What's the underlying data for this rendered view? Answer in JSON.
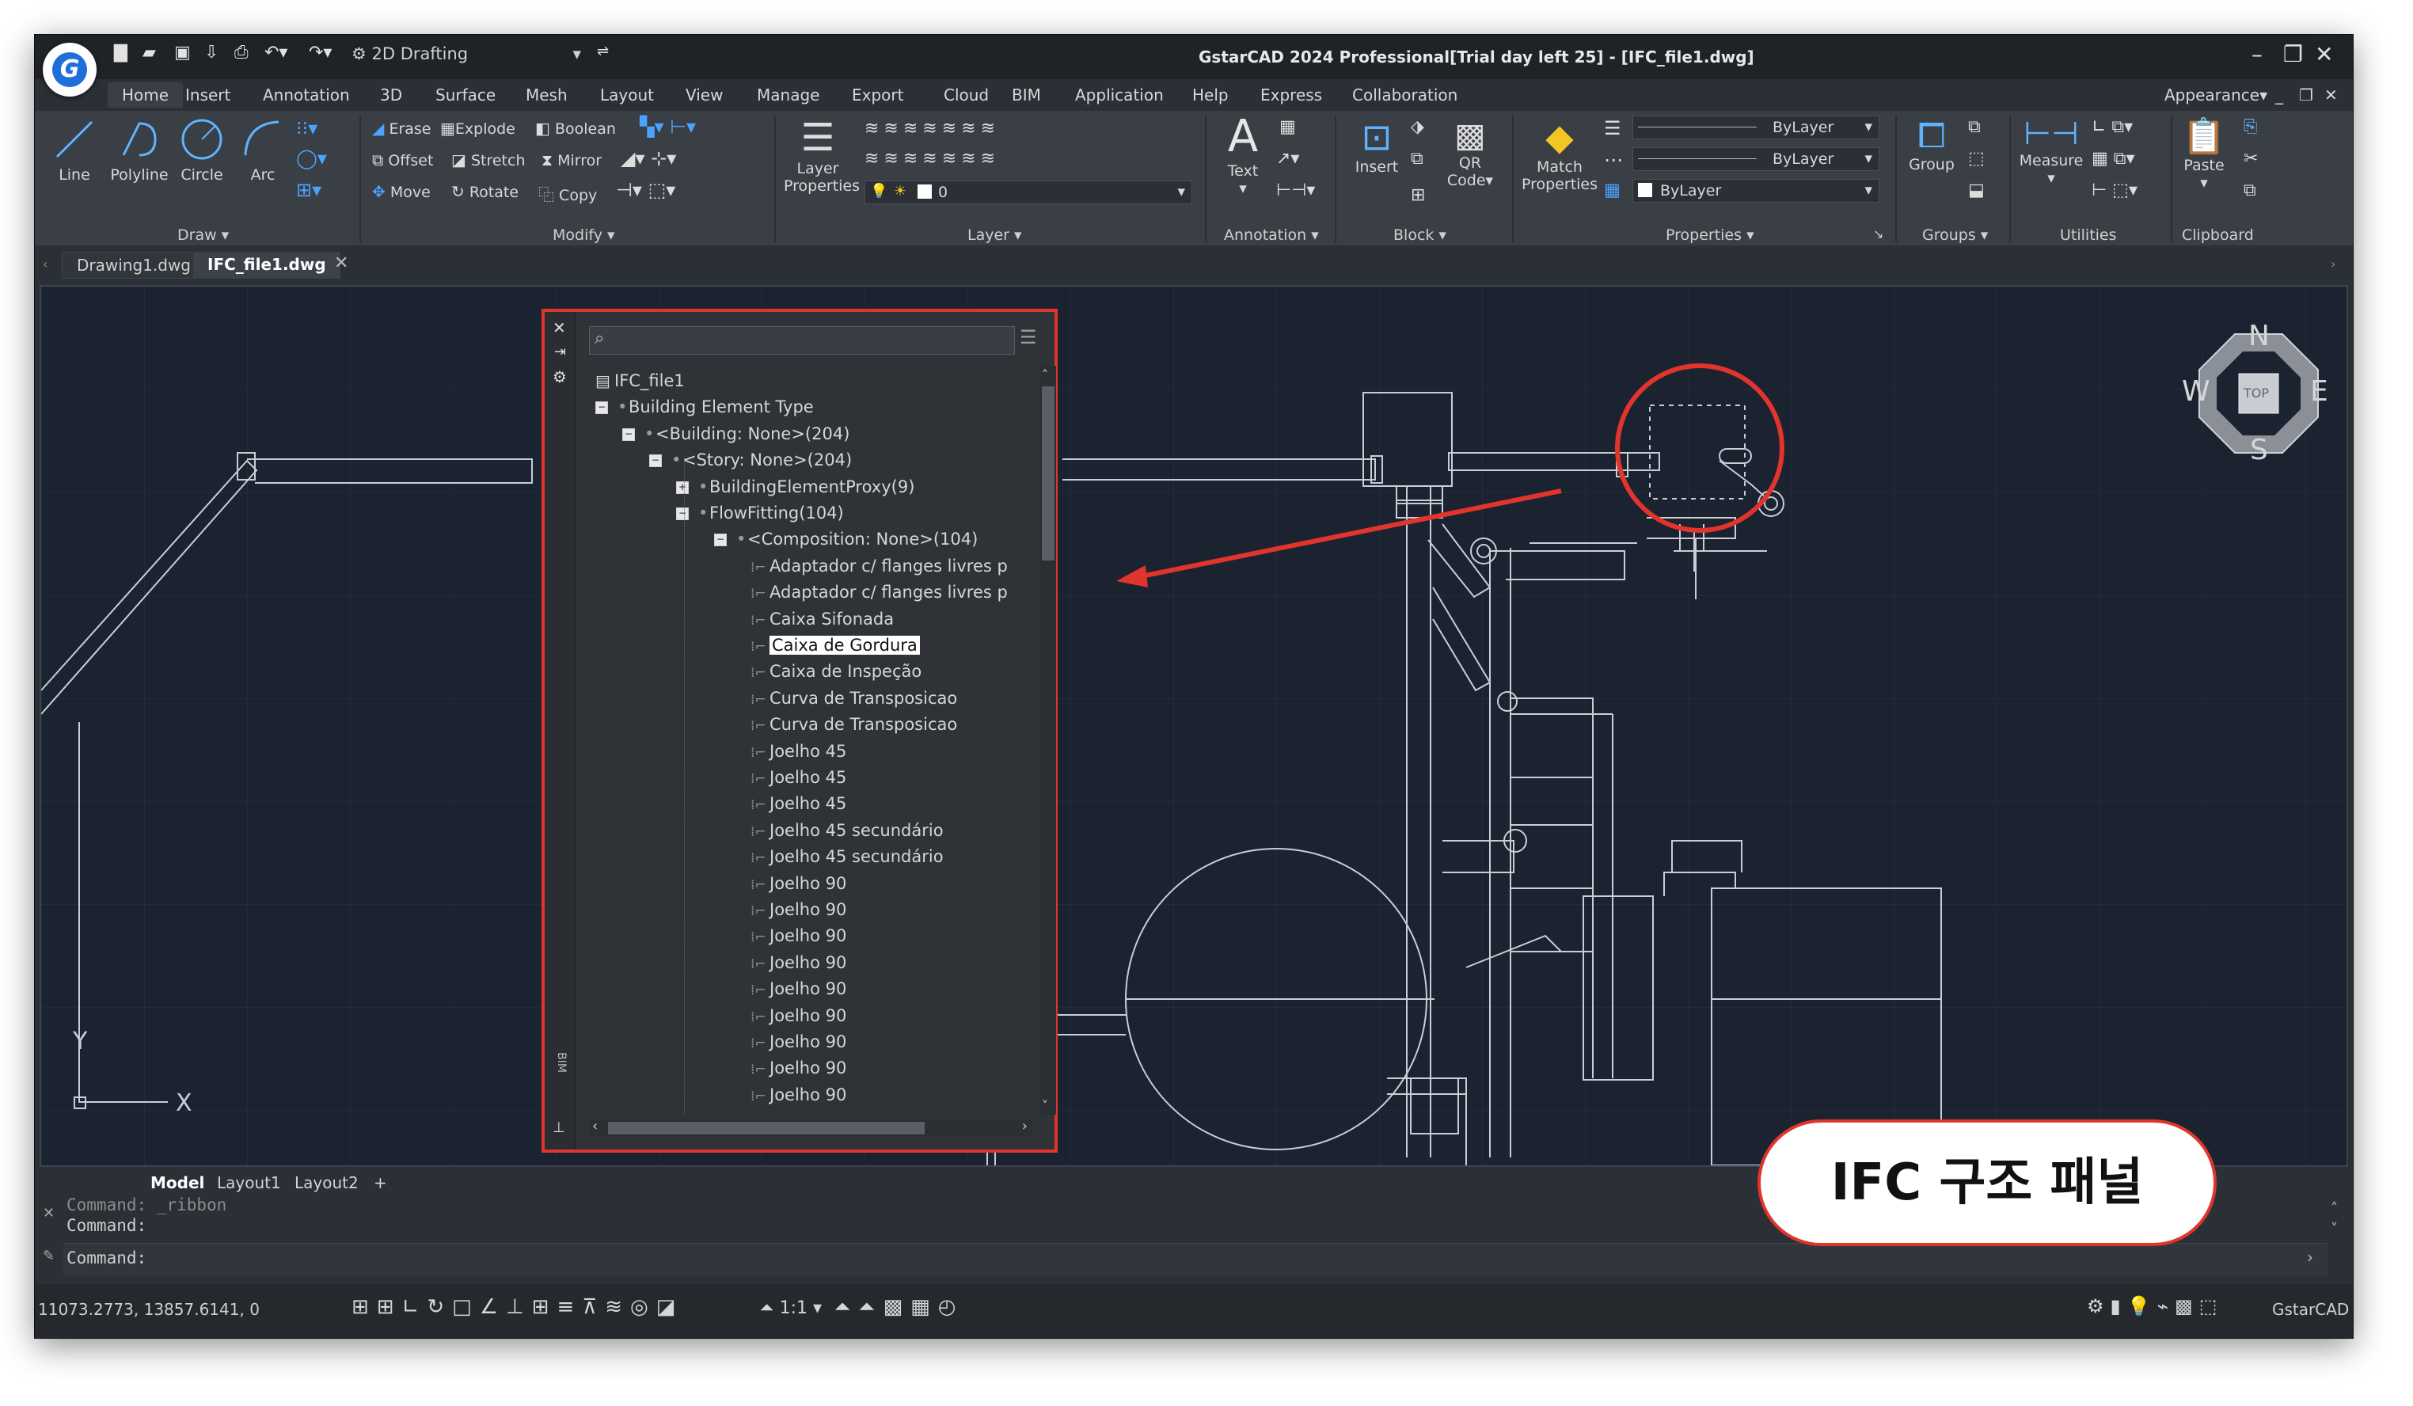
{
  "app": {
    "title": "GstarCAD 2024 Professional[Trial day left 25] - [IFC_file1.dwg]",
    "workspace": "2D Drafting",
    "appearance": "Appearance"
  },
  "menu": [
    "Home",
    "Insert",
    "Annotation",
    "3D",
    "Surface",
    "Mesh",
    "Layout",
    "View",
    "Manage",
    "Export",
    "Cloud",
    "BIM",
    "Application",
    "Help",
    "Express",
    "Collaboration"
  ],
  "ribbon": {
    "draw": {
      "group": "Draw",
      "line": "Line",
      "polyline": "Polyline",
      "circle": "Circle",
      "arc": "Arc"
    },
    "modify": {
      "group": "Modify",
      "erase": "Erase",
      "explode": "Explode",
      "boolean": "Boolean",
      "offset": "Offset",
      "stretch": "Stretch",
      "mirror": "Mirror",
      "move": "Move",
      "rotate": "Rotate",
      "copy": "Copy"
    },
    "layer": {
      "group": "Layer",
      "layer_props": "Layer",
      "layer_props2": "Properties",
      "current_layer": "0"
    },
    "annotation": {
      "group": "Annotation",
      "text": "Text"
    },
    "block": {
      "group": "Block",
      "insert": "Insert",
      "qr": "QR",
      "qr2": "Code"
    },
    "properties": {
      "group": "Properties",
      "match": "Match",
      "match2": "Properties",
      "bylayer1": "ByLayer",
      "bylayer2": "ByLayer",
      "bylayer3": "ByLayer"
    },
    "groups": {
      "group": "Groups",
      "group_btn": "Group"
    },
    "utilities": {
      "group": "Utilities",
      "measure": "Measure"
    },
    "clipboard": {
      "group": "Clipboard",
      "paste": "Paste"
    }
  },
  "doc_tabs": [
    "Drawing1.dwg",
    "IFC_file1.dwg"
  ],
  "layout_tabs": [
    "Model",
    "Layout1",
    "Layout2",
    "+"
  ],
  "command": {
    "line1": "Command: _ribbon",
    "line2": "Command:",
    "line3": "Command:"
  },
  "status": {
    "coords": "11073.2773, 13857.6141, 0",
    "scale": "1:1",
    "product": "GstarCAD"
  },
  "compass": {
    "n": "N",
    "s": "S",
    "e": "E",
    "w": "W",
    "top": "TOP"
  },
  "ucs": {
    "x": "X",
    "y": "Y"
  },
  "ifc_panel": {
    "side_label": "BIM",
    "tree": [
      {
        "label": "IFC_file1",
        "level": 0,
        "kind": "file"
      },
      {
        "label": "Building Element Type",
        "level": 0,
        "kind": "expanded"
      },
      {
        "label": "<Building: None>(204)",
        "level": 1,
        "kind": "expanded"
      },
      {
        "label": "<Story: None>(204)",
        "level": 2,
        "kind": "expanded"
      },
      {
        "label": "BuildingElementProxy(9)",
        "level": 3,
        "kind": "collapsed"
      },
      {
        "label": "FlowFitting(104)",
        "level": 3,
        "kind": "expanded"
      },
      {
        "label": "<Composition: None>(104)",
        "level": 4,
        "kind": "expanded"
      },
      {
        "label": "Adaptador c/ flanges livres p",
        "level": 5,
        "kind": "leaf"
      },
      {
        "label": "Adaptador c/ flanges livres p",
        "level": 5,
        "kind": "leaf"
      },
      {
        "label": "Caixa Sifonada",
        "level": 5,
        "kind": "leaf"
      },
      {
        "label": "Caixa de Gordura",
        "level": 5,
        "kind": "leaf",
        "selected": true
      },
      {
        "label": "Caixa de Inspeção",
        "level": 5,
        "kind": "leaf"
      },
      {
        "label": "Curva de Transposicao",
        "level": 5,
        "kind": "leaf"
      },
      {
        "label": "Curva de Transposicao",
        "level": 5,
        "kind": "leaf"
      },
      {
        "label": "Joelho 45",
        "level": 5,
        "kind": "leaf"
      },
      {
        "label": "Joelho 45",
        "level": 5,
        "kind": "leaf"
      },
      {
        "label": "Joelho 45",
        "level": 5,
        "kind": "leaf"
      },
      {
        "label": "Joelho 45 secundário",
        "level": 5,
        "kind": "leaf"
      },
      {
        "label": "Joelho 45 secundário",
        "level": 5,
        "kind": "leaf"
      },
      {
        "label": "Joelho 90",
        "level": 5,
        "kind": "leaf"
      },
      {
        "label": "Joelho 90",
        "level": 5,
        "kind": "leaf"
      },
      {
        "label": "Joelho 90",
        "level": 5,
        "kind": "leaf"
      },
      {
        "label": "Joelho 90",
        "level": 5,
        "kind": "leaf"
      },
      {
        "label": "Joelho 90",
        "level": 5,
        "kind": "leaf"
      },
      {
        "label": "Joelho 90",
        "level": 5,
        "kind": "leaf"
      },
      {
        "label": "Joelho 90",
        "level": 5,
        "kind": "leaf"
      },
      {
        "label": "Joelho 90",
        "level": 5,
        "kind": "leaf"
      },
      {
        "label": "Joelho 90",
        "level": 5,
        "kind": "leaf"
      }
    ]
  },
  "callout": {
    "text": "IFC 구조 패널"
  },
  "colors": {
    "accent": "#e0342c",
    "canvas": "#1b2230",
    "ribbon": "#3a3e45"
  }
}
